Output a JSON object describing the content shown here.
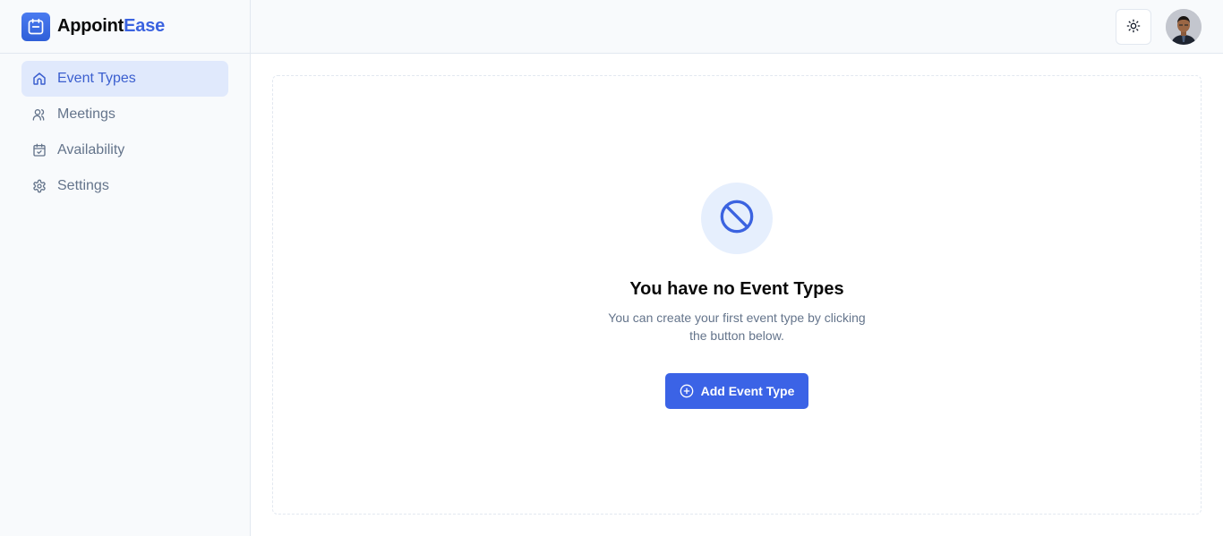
{
  "app": {
    "name_primary": "Appoint",
    "name_accent": "Ease",
    "accent_color": "#3b63e0"
  },
  "sidebar": {
    "items": [
      {
        "label": "Event Types",
        "icon": "home-icon",
        "active": true
      },
      {
        "label": "Meetings",
        "icon": "users-icon",
        "active": false
      },
      {
        "label": "Availability",
        "icon": "calendar-check-icon",
        "active": false
      },
      {
        "label": "Settings",
        "icon": "gear-icon",
        "active": false
      }
    ]
  },
  "header": {
    "theme_toggle_icon": "sun-icon",
    "avatar_alt": "User avatar"
  },
  "empty_state": {
    "icon": "ban-icon",
    "title": "You have no Event Types",
    "description": "You can create your first event type by clicking the button below.",
    "button_label": "Add Event Type",
    "button_icon": "plus-circle-icon"
  }
}
